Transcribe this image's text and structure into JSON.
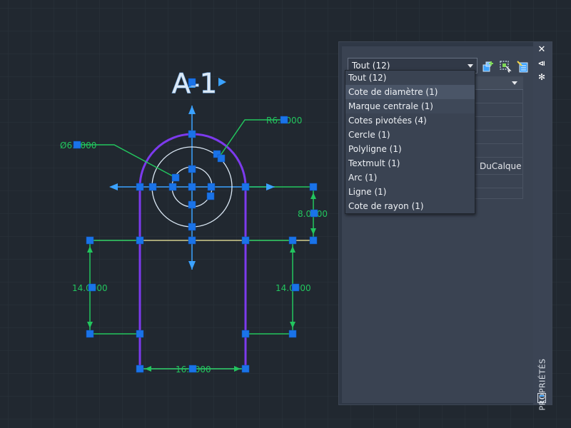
{
  "drawing": {
    "view_label": "A-1",
    "dimensions": {
      "diameter": "Ø6.0000",
      "radius": "R6.0000",
      "right_vertical": "8.0000",
      "left_height": "14.0000",
      "right_height": "14.0000",
      "bottom_width": "16.0000"
    }
  },
  "properties_palette": {
    "selection_combo": "Tout (12)",
    "dropdown_items": [
      "Tout (12)",
      "Cote de diamètre (1)",
      "Marque centrale (1)",
      "Cotes pivotées (4)",
      "Cercle (1)",
      "Polyligne (1)",
      "Textmult (1)",
      "Arc (1)",
      "Ligne (1)",
      "Cote de rayon (1)"
    ],
    "visible_property_value": "DuCalque",
    "side_label": "PROPRIÉTÉS",
    "icons": {
      "close": "close-icon",
      "autohide": "auto-hide-icon",
      "settings": "settings-icon",
      "quick_select": "quick-select-icon",
      "select_objects": "select-objects-icon",
      "pickadd": "toggle-pickadd-icon"
    }
  },
  "colors": {
    "background": "#212830",
    "grid": "#2b333c",
    "grip": "#1a73e8",
    "dimension": "#22c55e",
    "arc": "#7c3aed",
    "geometry": "#dbe8f5",
    "highlight": "#3ba2ff"
  }
}
